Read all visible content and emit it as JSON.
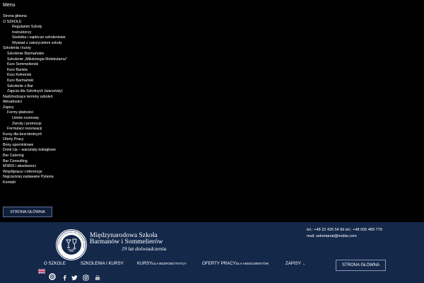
{
  "menu": {
    "title": "Menu",
    "items": [
      {
        "label": "Strona główna",
        "level": 1
      },
      {
        "label": "O SZKOLE",
        "level": 1
      },
      {
        "label": "Regulamin Szkoły",
        "level": 3
      },
      {
        "label": "Instruktorzy",
        "level": 3
      },
      {
        "label": "Siedziba i zaplecze szkoleniowe",
        "level": 3
      },
      {
        "label": "Wywiad z założycielem szkoły",
        "level": 3
      },
      {
        "label": "Szkolenia i kursy",
        "level": 1
      },
      {
        "label": "Szkolenie Barmańskie",
        "level": 2
      },
      {
        "label": "Szkolenie „Mikstologia Molekularna”",
        "level": 2
      },
      {
        "label": "Kurs Sommelierski",
        "level": 2
      },
      {
        "label": "Kurs Barista",
        "level": 2
      },
      {
        "label": "Kurs Kelnerski",
        "level": 2
      },
      {
        "label": "Kurs Barmański",
        "level": 2
      },
      {
        "label": "Szkolenie z Bar",
        "level": 2
      },
      {
        "label": "Zajęcia dla Szkolnych (warsztaty)",
        "level": 2
      },
      {
        "label": "Nadchodzące terminy szkoleń",
        "level": 1
      },
      {
        "label": "Aktualności",
        "level": 1
      },
      {
        "label": "Zapisy",
        "level": 1
      },
      {
        "label": "Formy płatności",
        "level": 2
      },
      {
        "label": "Umów rozmowę",
        "level": 3
      },
      {
        "label": "Zwroty i promocje",
        "level": 3
      },
      {
        "label": "Formularz rezerwacji",
        "level": 2
      },
      {
        "label": "Kursy dla bezrobotnych",
        "level": 1
      },
      {
        "label": "Oferty Pracy",
        "level": 1
      },
      {
        "label": "Bony upominkowe",
        "level": 1
      },
      {
        "label": "Drink Up – warsztaty koktajlowe",
        "level": 1
      },
      {
        "label": "Bar Catering",
        "level": 1
      },
      {
        "label": "Bar Consulting",
        "level": 1
      },
      {
        "label": "MSBIS i absolwenci",
        "level": 1
      },
      {
        "label": "Współpraca i referencje",
        "level": 1
      },
      {
        "label": "Najczęściej zadawane Pytania",
        "level": 1
      },
      {
        "label": "Kontakt",
        "level": 1
      }
    ],
    "home_button": "STRONA GŁÓWNA"
  },
  "footer": {
    "logo": {
      "line1": "Międzynarodowa Szkoła",
      "line2": "Barmanów i Sommelierów",
      "years": "19 lat doświadczenia",
      "seal_text": "International Bartender and Sommelier School"
    },
    "contact": {
      "phones": "tel.: +48 22 425 54 66   tel.: +48 505 489 779",
      "email": "mail: sekretariat@msbis.com"
    },
    "nav": [
      {
        "main": "O SZKOLE",
        "sub": ""
      },
      {
        "main": "SZKOLENIA I KURSY",
        "sub": ""
      },
      {
        "main": "KURSY",
        "sub": "DLA BEZROBOTNYCH"
      },
      {
        "main": "OFERTY PRACY",
        "sub": "DLA ABSOLWENTÓW"
      },
      {
        "main": "ZAPISY",
        "sub": ""
      }
    ],
    "home_button": "STRONA GŁÓWNA",
    "language_icon": "uk-flag-icon",
    "social_icons": [
      "instagram-round-icon",
      "facebook-icon",
      "twitter-icon",
      "instagram-icon",
      "youtube-icon"
    ]
  },
  "colors": {
    "page_bg": "#000000",
    "footer_bg": "#14284a",
    "button_bg": "#101f3b",
    "button_border": "#5b6f97"
  }
}
